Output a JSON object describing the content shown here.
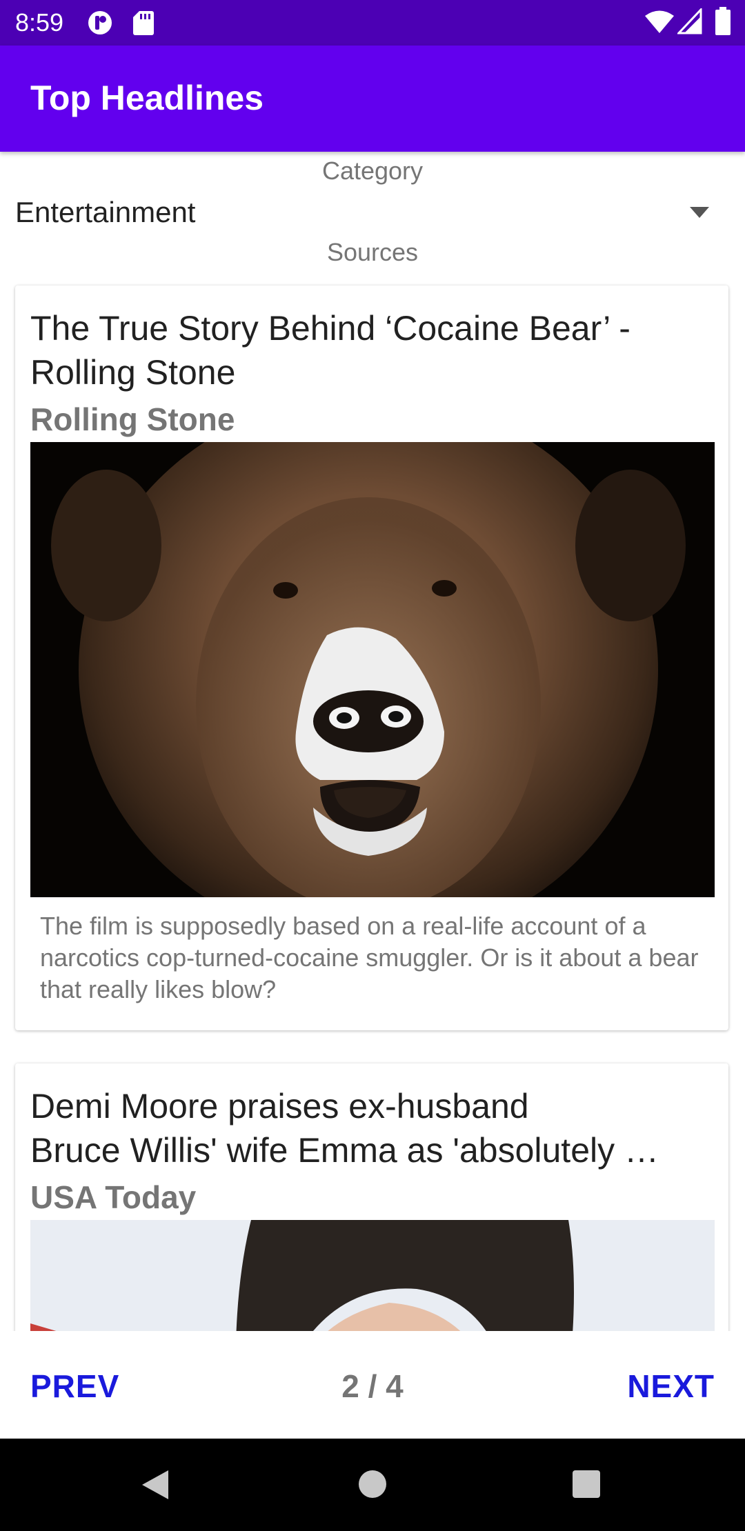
{
  "status_bar": {
    "time": "8:59",
    "icons": [
      "privacy-dot-icon",
      "sd-card-icon",
      "wifi-icon",
      "signal-icon",
      "battery-icon"
    ]
  },
  "app_bar": {
    "title": "Top Headlines",
    "color": "#6200ee"
  },
  "filters": {
    "category_label": "Category",
    "category_value": "Entertainment",
    "sources_label": "Sources"
  },
  "articles": [
    {
      "title_line1": "The True Story Behind ‘Cocaine Bear’ -",
      "title_line2": "Rolling Stone",
      "source": "Rolling Stone",
      "description": "The film is supposedly based on a real-life account of a narcotics cop-turned-cocaine smuggler. Or is it about a bear that really likes blow?"
    },
    {
      "title_line1": "Demi Moore praises ex-husband",
      "title_line2": "Bruce Willis' wife Emma as 'absolutely …",
      "source": "USA Today"
    }
  ],
  "pager": {
    "prev_label": "PREV",
    "page": "2 / 4",
    "next_label": "NEXT",
    "accent": "#1a1adc"
  },
  "nav_bar": {
    "icons": [
      "back-icon",
      "home-icon",
      "recents-icon"
    ]
  }
}
